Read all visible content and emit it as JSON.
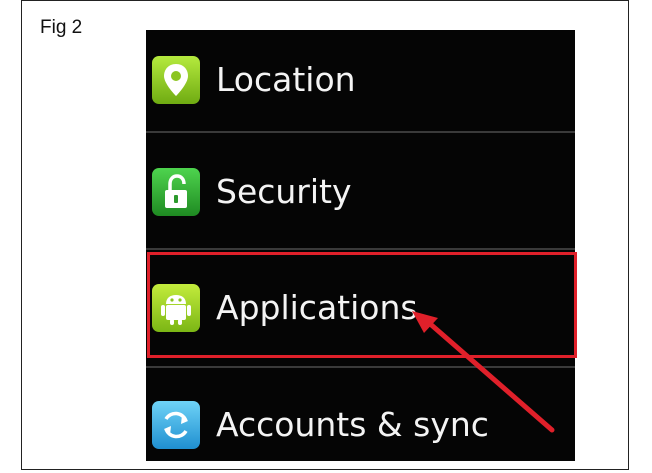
{
  "figure": {
    "label": "Fig 2"
  },
  "settings": {
    "items": [
      {
        "label": "Location",
        "icon": "location-pin-icon"
      },
      {
        "label": "Security",
        "icon": "padlock-icon"
      },
      {
        "label": "Applications",
        "icon": "android-icon"
      },
      {
        "label": "Accounts & sync",
        "icon": "sync-icon"
      }
    ],
    "highlighted_item": "Applications"
  },
  "colors": {
    "highlight": "#e0202a",
    "background": "#050505",
    "text": "#f4f4f4"
  }
}
